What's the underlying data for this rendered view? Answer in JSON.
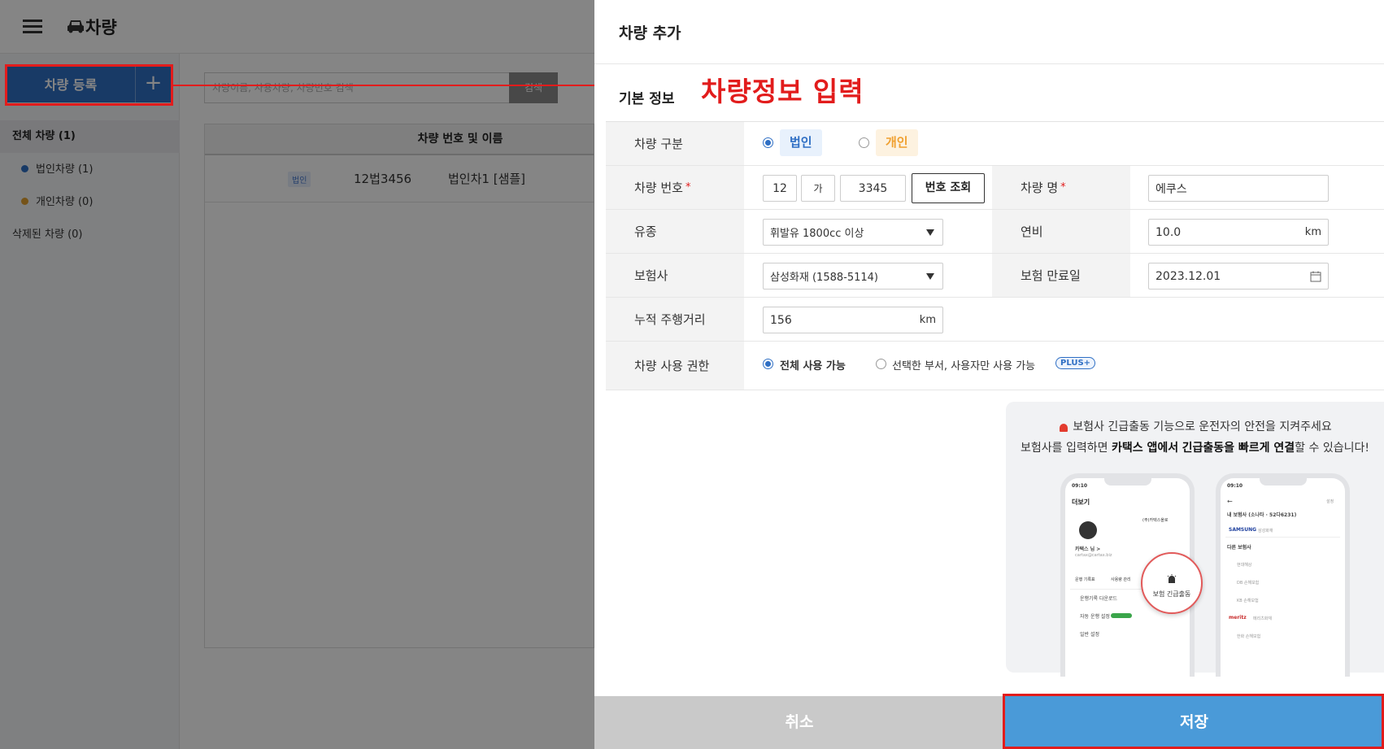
{
  "app": {
    "title": "차량",
    "register_label": "차량 등록",
    "search_placeholder": "차량이름, 사용차량, 차량번호 검색",
    "search_button": "검색",
    "sidebar": {
      "all": "전체 차량 (1)",
      "corporate": "법인차량 (1)",
      "personal": "개인차량 (0)",
      "deleted": "삭제된 차량 (0)"
    },
    "table": {
      "header": "차량 번호 및 이름",
      "rows": [
        {
          "badge": "법인",
          "plate": "12법3456",
          "name": "법인차1 [샘플]"
        }
      ]
    }
  },
  "annotation": {
    "text": "차량정보 입력"
  },
  "panel": {
    "title": "차량 추가",
    "section": "기본 정보",
    "fields": {
      "type_label": "차량 구분",
      "type_corp": "법인",
      "type_personal": "개인",
      "plate_label": "차량 번호",
      "plate_part1": "12",
      "plate_part2": "가",
      "plate_part3": "3345",
      "lookup_button": "번호 조회",
      "name_label": "차량 명",
      "name_value": "에쿠스",
      "fuel_label": "유종",
      "fuel_value": "휘발유 1800cc 이상",
      "efficiency_label": "연비",
      "efficiency_value": "10.0",
      "efficiency_unit": "km",
      "insurer_label": "보험사",
      "insurer_value": "삼성화재 (1588-5114)",
      "expiry_label": "보험 만료일",
      "expiry_value": "2023.12.01",
      "mileage_label": "누적 주행거리",
      "mileage_value": "156",
      "mileage_unit": "km",
      "perm_label": "차량 사용 권한",
      "perm_all": "전체 사용 가능",
      "perm_selected": "선택한 부서, 사용자만 사용 가능",
      "perm_badge": "PLUS+",
      "required_mark": "*"
    },
    "promo": {
      "line1": "보험사 긴급출동 기능으로 운전자의 안전을 지켜주세요",
      "line2_pre": "보험사를 입력하면 ",
      "line2_bold1": "카택스 앱에서",
      "line2_mid": " ",
      "line2_bold2": "긴급출동을 빠르게 연결",
      "line2_post": "할 수 있습니다!",
      "bubble": "보험 긴급출동",
      "phone1": {
        "time": "09:10",
        "title": "더보기",
        "company": "(주)카택스올로",
        "user": "카택스 님 >",
        "email": "cartax@cartax.biz",
        "menu1": "운행기록 다운로드",
        "menu2": "자동 운행 설정",
        "menu3": "일반 설정",
        "icon1": "운행 기록표",
        "icon2": "사용량 관리"
      },
      "phone2": {
        "time": "09:10",
        "edit": "설정",
        "my_insurer": "내 보험사 (소나타 · 52다6231)",
        "insurer1": "삼성화재",
        "other": "다른 보험사",
        "insurer2": "현대해상",
        "insurer3": "DB 손해보험",
        "insurer4": "KB 손해보험",
        "insurer5": "메리츠화재",
        "insurer6": "한화 손해보험",
        "brand_samsung": "SAMSUNG",
        "brand_meritz": "meritz"
      }
    },
    "cancel": "취소",
    "save": "저장"
  },
  "colors": {
    "primary": "#2f6fc4",
    "save": "#4a9ad8",
    "cancel": "#c9c9c9",
    "annotation": "#e21c1c",
    "corp_dot": "#2f6fc4",
    "personal_dot": "#e0a030"
  }
}
